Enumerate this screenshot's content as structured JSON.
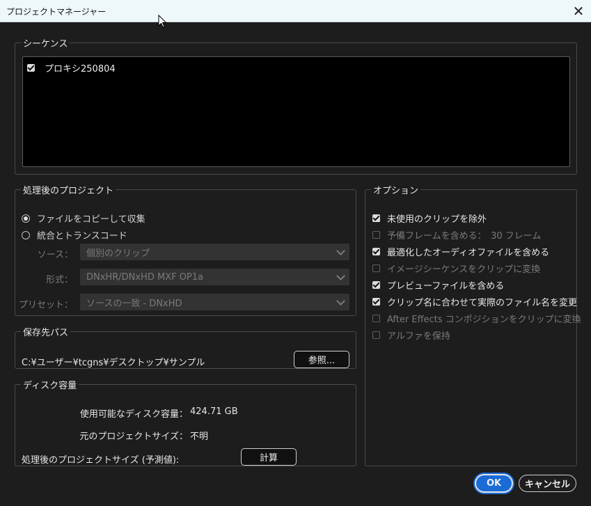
{
  "window": {
    "title": "プロジェクトマネージャー",
    "close_glyph": "✕"
  },
  "sequences": {
    "legend": "シーケンス",
    "items": [
      {
        "label": "プロキシ250804",
        "checked": true
      }
    ]
  },
  "processed_project": {
    "legend": "処理後のプロジェクト",
    "radio_copy": "ファイルをコピーして収集",
    "radio_transcode": "統合とトランスコード",
    "source_label": "ソース：",
    "source_value": "個別のクリップ",
    "format_label": "形式：",
    "format_value": "DNxHR/DNxHD MXF OP1a",
    "preset_label": "プリセット：",
    "preset_value": "ソースの一致 - DNxHD"
  },
  "destination": {
    "legend": "保存先パス",
    "path": "C:¥ユーザー¥tcgns¥デスクトップ¥サンプル",
    "browse_label": "参照..."
  },
  "disk": {
    "legend": "ディスク容量",
    "available_label": "使用可能なディスク容量：",
    "available_value": "424.71 GB",
    "original_label": "元のプロジェクトサイズ：",
    "original_value": "不明",
    "processed_label": "処理後のプロジェクトサイズ (予測値):",
    "calculate_label": "計算"
  },
  "options": {
    "legend": "オプション",
    "items": [
      {
        "label": "未使用のクリップを除外",
        "checked": true,
        "enabled": true
      },
      {
        "label": "予備フレームを含める：　30 フレーム",
        "checked": false,
        "enabled": false
      },
      {
        "label": "最適化したオーディオファイルを含める",
        "checked": true,
        "enabled": true
      },
      {
        "label": "イメージシーケンスをクリップに変換",
        "checked": false,
        "enabled": false
      },
      {
        "label": "プレビューファイルを含める",
        "checked": true,
        "enabled": true
      },
      {
        "label": "クリップ名に合わせて実際のファイル名を変更",
        "checked": true,
        "enabled": true
      },
      {
        "label": "After Effects コンポジションをクリップに変換",
        "checked": false,
        "enabled": false
      },
      {
        "label": "アルファを保持",
        "checked": false,
        "enabled": false
      }
    ]
  },
  "footer": {
    "ok_label": "OK",
    "cancel_label": "キャンセル"
  }
}
